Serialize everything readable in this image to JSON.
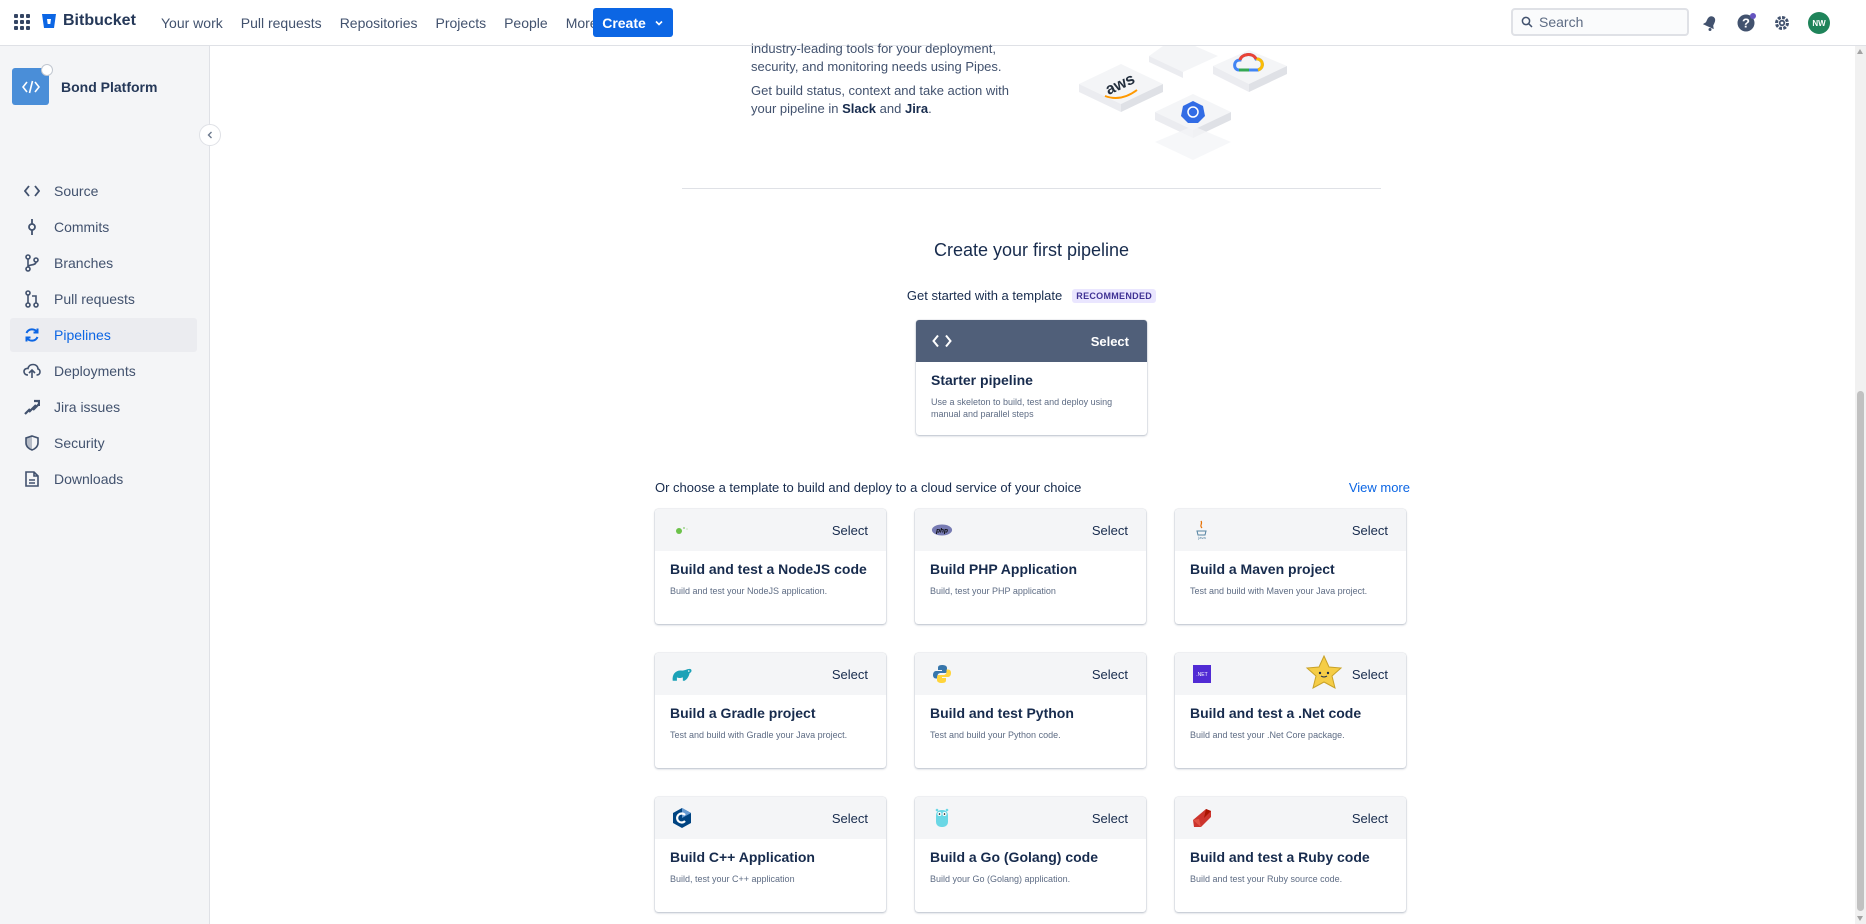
{
  "topnav": {
    "brand": "Bitbucket",
    "links": [
      "Your work",
      "Pull requests",
      "Repositories",
      "Projects",
      "People"
    ],
    "more_label": "More",
    "create_label": "Create",
    "search_placeholder": "Search",
    "avatar_initials": "NW",
    "icons": [
      "app-switcher-icon",
      "notifications-icon",
      "help-icon",
      "settings-icon"
    ]
  },
  "sidebar": {
    "repo_name": "Bond Platform",
    "items": [
      {
        "label": "Source",
        "icon": "source-icon",
        "active": false
      },
      {
        "label": "Commits",
        "icon": "commits-icon",
        "active": false
      },
      {
        "label": "Branches",
        "icon": "branches-icon",
        "active": false
      },
      {
        "label": "Pull requests",
        "icon": "pull-requests-icon",
        "active": false
      },
      {
        "label": "Pipelines",
        "icon": "pipelines-icon",
        "active": true
      },
      {
        "label": "Deployments",
        "icon": "deployments-icon",
        "active": false
      },
      {
        "label": "Jira issues",
        "icon": "jira-icon",
        "active": false
      },
      {
        "label": "Security",
        "icon": "shield-icon",
        "active": false
      },
      {
        "label": "Downloads",
        "icon": "downloads-icon",
        "active": false
      }
    ]
  },
  "intro": {
    "line1": "industry-leading tools for your deployment,",
    "line2": "security, and monitoring needs using Pipes.",
    "p2_start": "Get build status, context and take action with",
    "p2_mid": "your pipeline in ",
    "slack": "Slack",
    "and": " and ",
    "jira": "Jira",
    "period": "."
  },
  "main": {
    "title": "Create your first pipeline",
    "subtitle": "Get started with a template",
    "badge": "RECOMMENDED",
    "starter": {
      "select": "Select",
      "title": "Starter pipeline",
      "desc": "Use a skeleton to build, test and deploy using manual and parallel steps"
    },
    "or_text": "Or choose a template to build and deploy to a cloud service of your choice",
    "view_more": "View more",
    "templates": [
      {
        "title": "Build and test a NodeJS code",
        "desc": "Build and test your NodeJS application.",
        "icon": "nodejs-icon",
        "select": "Select"
      },
      {
        "title": "Build PHP Application",
        "desc": "Build, test your PHP application",
        "icon": "php-icon",
        "select": "Select"
      },
      {
        "title": "Build a Maven project",
        "desc": "Test and build with Maven your Java project.",
        "icon": "java-icon",
        "select": "Select"
      },
      {
        "title": "Build a Gradle project",
        "desc": "Test and build with Gradle your Java project.",
        "icon": "gradle-icon",
        "select": "Select"
      },
      {
        "title": "Build and test Python",
        "desc": "Test and build your Python code.",
        "icon": "python-icon",
        "select": "Select"
      },
      {
        "title": "Build and test a .Net code",
        "desc": "Build and test your .Net Core package.",
        "icon": "dotnet-icon",
        "select": "Select"
      },
      {
        "title": "Build C++ Application",
        "desc": "Build, test your C++ application",
        "icon": "cpp-icon",
        "select": "Select"
      },
      {
        "title": "Build a Go (Golang) code",
        "desc": "Build your Go (Golang) application.",
        "icon": "golang-icon",
        "select": "Select"
      },
      {
        "title": "Build and test a Ruby code",
        "desc": "Build and test your Ruby source code.",
        "icon": "ruby-icon",
        "select": "Select"
      }
    ]
  },
  "cloud_illustration": {
    "labels": [
      "aws"
    ]
  },
  "colors": {
    "accent": "#0c66e4",
    "starter_bar": "#505f79",
    "badge_bg": "#eae6ff",
    "badge_text": "#403294"
  }
}
